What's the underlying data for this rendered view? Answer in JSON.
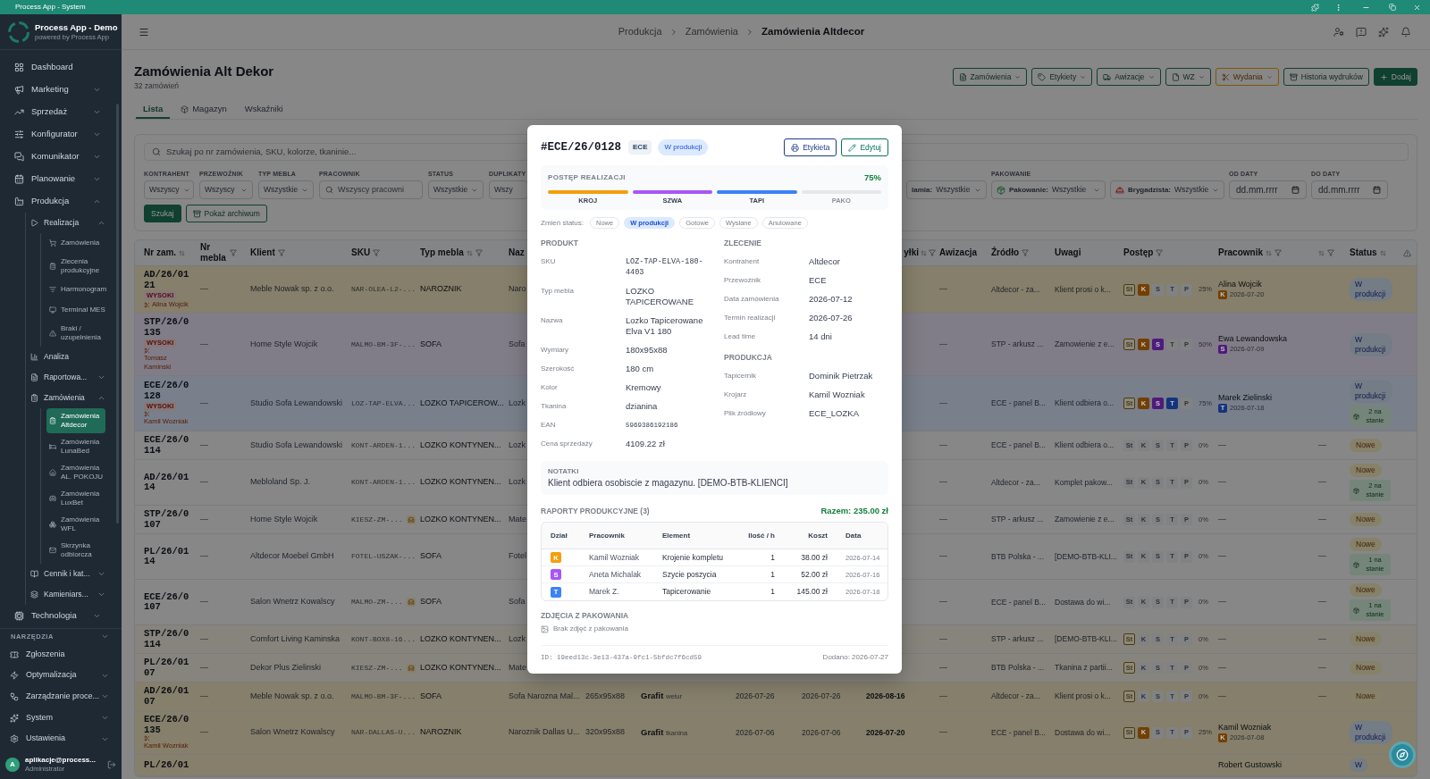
{
  "window": {
    "title": "Process App - System"
  },
  "sidebar": {
    "app_name": "Process App - Demo",
    "app_tagline": "powered by Process App",
    "items": [
      {
        "label": "Dashboard",
        "selected": false
      },
      {
        "label": "Marketing",
        "selected": false,
        "expanded": false
      },
      {
        "label": "Sprzedaż",
        "selected": false,
        "expanded": false
      },
      {
        "label": "Konfigurator",
        "selected": false,
        "expanded": false
      },
      {
        "label": "Komunikator",
        "selected": false,
        "expanded": false
      },
      {
        "label": "Planowanie",
        "selected": false,
        "expanded": false
      },
      {
        "label": "Produkcja",
        "selected": false,
        "expanded": true,
        "children": [
          {
            "label": "Realizacja",
            "selected": false,
            "expanded": true,
            "children": [
              {
                "label": "Zamówienia",
                "selected": false
              },
              {
                "label": "Zlecenia produkcyjne",
                "selected": false
              },
              {
                "label": "Harmonogram",
                "selected": false
              },
              {
                "label": "Terminal MES",
                "selected": false
              },
              {
                "label": "Braki / uzupełnienia",
                "selected": false
              }
            ]
          },
          {
            "label": "Analiza",
            "selected": false
          },
          {
            "label": "Raportowa...",
            "selected": false,
            "expanded": false
          },
          {
            "label": "Zamówienia",
            "selected": false,
            "expanded": true,
            "children": [
              {
                "label": "Zamówienia Altdecor",
                "selected": true
              },
              {
                "label": "Zamówienia LunaBed",
                "selected": false
              },
              {
                "label": "Zamówienia AL. POKOJU",
                "selected": false
              },
              {
                "label": "Zamówienia LuxBet",
                "selected": false
              },
              {
                "label": "Zamówienia WFL",
                "selected": false
              },
              {
                "label": "Skrzynka odbiorcza",
                "selected": false
              }
            ]
          },
          {
            "label": "Cennik i kat...",
            "selected": false,
            "expanded": false
          },
          {
            "label": "Kamieniars...",
            "selected": false,
            "expanded": false
          }
        ]
      },
      {
        "label": "Technologia",
        "selected": false,
        "expanded": false
      }
    ],
    "tools": {
      "title": "NARZĘDZIA",
      "expanded": true,
      "items": [
        {
          "label": "Zgłoszenia",
          "selected": false
        },
        {
          "label": "Optymalizacja",
          "selected": false,
          "expanded": false
        },
        {
          "label": "Zarządzanie proce...",
          "selected": false,
          "expanded": false
        },
        {
          "label": "System",
          "selected": false,
          "expanded": false
        },
        {
          "label": "Ustawienia",
          "selected": false,
          "expanded": false
        }
      ]
    },
    "user": {
      "initial": "A",
      "name": "aplikacje@process...",
      "role": "Administrator"
    }
  },
  "header": {
    "breadcrumbs": [
      {
        "label": "Produkcja",
        "current": false
      },
      {
        "label": "Zamówienia",
        "current": false
      },
      {
        "label": "Zamówienia Altdecor",
        "current": true
      }
    ]
  },
  "page": {
    "title": "Zamówienia Alt Dekor",
    "subtitle": "32 zamówień",
    "actions": [
      {
        "label": "Zamówienia",
        "kind": "outline",
        "dropdown": true
      },
      {
        "label": "Etykiety",
        "kind": "outline",
        "dropdown": true
      },
      {
        "label": "Awizacje",
        "kind": "outline",
        "dropdown": true
      },
      {
        "label": "WZ",
        "kind": "outline",
        "dropdown": true
      },
      {
        "label": "Wydania",
        "kind": "warning",
        "dropdown": true
      },
      {
        "label": "Historia wydruków",
        "kind": "outline",
        "dropdown": false
      },
      {
        "label": "Dodaj",
        "kind": "primary",
        "dropdown": false
      }
    ],
    "tabs": [
      {
        "label": "Lista",
        "selected": true
      },
      {
        "label": "Magazyn",
        "selected": false
      },
      {
        "label": "Wskaźniki",
        "selected": false
      }
    ]
  },
  "filters": {
    "search": {
      "placeholder": "Szukaj po nr zamówienia, SKU, kolorze, tkaninie..."
    },
    "fields": [
      {
        "label": "KONTRAHENT",
        "kind": "select",
        "value": "Wszyscy",
        "dropdown": true
      },
      {
        "label": "PRZEWOŹNIK",
        "kind": "select",
        "value": "Wszyscy",
        "dropdown": true
      },
      {
        "label": "TYP MEBLA",
        "kind": "select",
        "value": "Wszystkie",
        "dropdown": true
      },
      {
        "label": "PRACOWNIK",
        "kind": "search",
        "placeholder": "Wszyscy pracowni"
      },
      {
        "label": "STATUS",
        "kind": "select",
        "value": "Wszystkie",
        "dropdown": true
      },
      {
        "label": "DUPLIKATY",
        "kind": "select",
        "value": "Wszy"
      }
    ],
    "more_fields": [
      {
        "kind": "select",
        "prefix": "lamia:",
        "value": "Wszystkie",
        "dropdown": true
      },
      {
        "label": "PAKOWANIE",
        "kind": "select",
        "prefix": "Pakowanie:",
        "value": "Wszystkie",
        "dropdown": true
      },
      {
        "kind": "select",
        "prefix": "Brygadzista:",
        "value": "Wszystkie",
        "dropdown": true
      },
      {
        "label": "OD DATY",
        "kind": "date",
        "placeholder": "dd.mm.rrrr"
      },
      {
        "label": "DO DATY",
        "kind": "date",
        "placeholder": "dd.mm.rrrr"
      }
    ],
    "buttons": [
      {
        "label": "Szukaj",
        "kind": "primary"
      },
      {
        "label": "Pokaż archiwum",
        "kind": "outline"
      }
    ]
  },
  "table": {
    "columns": [
      {
        "label": "Nr zam.",
        "sort": true,
        "filter": false
      },
      {
        "label": "Nr mebla",
        "sort": false,
        "filter": true
      },
      {
        "label": "Klient",
        "sort": false,
        "filter": true
      },
      {
        "label": "SKU",
        "sort": false,
        "filter": true
      },
      {
        "label": "Typ mebla",
        "sort": true,
        "filter": true
      },
      {
        "label": "Naz",
        "sort": false,
        "filter": false
      },
      {
        "label": "yłki",
        "sort": true,
        "filter": true
      },
      {
        "label": "Awizacja",
        "sort": false,
        "filter": false
      },
      {
        "label": "Źródło",
        "sort": false,
        "filter": true
      },
      {
        "label": "Uwagi",
        "sort": false,
        "filter": false
      },
      {
        "label": "Postęp",
        "sort": false,
        "filter": true
      },
      {
        "label": "Pracownik",
        "sort": true,
        "filter": true
      },
      {
        "sort": true,
        "filter": true
      },
      {
        "label": "Status",
        "sort": true,
        "filter": false
      },
      {
        "kind": "warning"
      }
    ],
    "rows": [
      {
        "color": "#857f6b",
        "order_no": "AD/26/0121",
        "priority": "WYSOKI",
        "cutter": "Alina Wojcik",
        "furniture_no": "—",
        "client": "Meble Nowak sp. z o.o.",
        "sku": "NAR-OLEA-L2-...",
        "type": "NAROZNIK",
        "column_6": "Naro",
        "advice": "—",
        "source": "Altdecor - za...",
        "notes": "Klient prosi o k...",
        "steps": [
          {
            "label": "St",
            "done": false,
            "active": true,
            "color": "#4d3a08"
          },
          {
            "label": "K",
            "done": true,
            "color": "#733f03"
          },
          {
            "label": "S",
            "done": false,
            "active": false
          },
          {
            "label": "T",
            "done": false,
            "active": false
          },
          {
            "label": "P",
            "done": false,
            "active": false
          }
        ],
        "progress": "25%",
        "worker": {
          "kind": "assigned",
          "name": "Alina Wojcik",
          "step": "K",
          "color": "#733f03",
          "date": "2026-07-20"
        },
        "status": {
          "label": "W produkcji",
          "kind": "in_production"
        }
      },
      {
        "color": "#817d88",
        "order_no": "STP/26/0135",
        "priority": "WYSOKI",
        "cutter": "Tomasz Kaminski",
        "furniture_no": "—",
        "client": "Home Style Wojcik",
        "sku": "MALMO-BM-3F-...",
        "type": "SOFA",
        "column_6": "Sofa",
        "advice": "—",
        "source": "STP - arkusz ...",
        "notes": "Zamowienie z e...",
        "steps": [
          {
            "label": "St",
            "done": false,
            "active": true,
            "color": "#4d3a08"
          },
          {
            "label": "K",
            "done": true,
            "color": "#733f03"
          },
          {
            "label": "S",
            "done": true,
            "color": "#4e1b7c"
          },
          {
            "label": "T",
            "done": false,
            "active": false
          },
          {
            "label": "P",
            "done": false,
            "active": false
          }
        ],
        "progress": "50%",
        "worker": {
          "kind": "assigned",
          "name": "Ewa Lewandowska",
          "step": "S",
          "color": "#4e1b7c",
          "date": "2026-07-09"
        },
        "status": {
          "label": "W produkcji",
          "kind": "in_production"
        }
      },
      {
        "color": "#79808b",
        "order_no": "ECE/26/0128",
        "priority": "WYSOKI",
        "cutter": "Kamil Wozniak",
        "furniture_no": "—",
        "client": "Studio Sofa Lewandowski",
        "sku": "LOZ-TAP-ELVA...",
        "type": "LOZKO TAPICEROW...",
        "column_6": "Lozk",
        "advice": "—",
        "source": "ECE - panel B...",
        "notes": "Klient odbiera o...",
        "steps": [
          {
            "label": "St",
            "done": false,
            "active": true,
            "color": "#4d3a08"
          },
          {
            "label": "K",
            "done": true,
            "color": "#733f03"
          },
          {
            "label": "S",
            "done": true,
            "color": "#4e1b7c"
          },
          {
            "label": "T",
            "done": true,
            "color": "#14347d"
          },
          {
            "label": "P",
            "done": false,
            "active": false
          }
        ],
        "progress": "75%",
        "worker": {
          "kind": "assigned",
          "name": "Marek Zielinski",
          "step": "T",
          "color": "#14347d",
          "date": "2026-07-18"
        },
        "status": {
          "label": "W produkcji",
          "kind": "in_production"
        },
        "stock": "2 na stanie"
      },
      {
        "color": "#878787",
        "order_no": "ECE/26/0114",
        "furniture_no": "—",
        "client": "Studio Sofa Lewandowski",
        "sku": "KONT-ARDEN-1...",
        "type": "LOZKO KONTYNEN...",
        "column_6": "Lozk",
        "advice": "—",
        "source": "ECE - panel B...",
        "notes": "Klient odbiera o...",
        "steps": [
          {
            "label": "St",
            "done": false,
            "active": false
          },
          {
            "label": "K",
            "done": false,
            "active": false
          },
          {
            "label": "S",
            "done": false,
            "active": false
          },
          {
            "label": "T",
            "done": false,
            "active": false
          },
          {
            "label": "P",
            "done": false,
            "active": false
          }
        ],
        "progress": "0%",
        "worker": {
          "kind": "none",
          "name": "—"
        },
        "column_17": "—",
        "status": {
          "label": "Nowe",
          "kind": "new"
        }
      },
      {
        "color": "#878787",
        "order_no": "AD/26/0114",
        "furniture_no": "—",
        "client": "Mebloland Sp. J.",
        "sku": "KONT-ARDEN-1...",
        "type": "LOZKO KONTYNEN...",
        "column_6": "Lozk",
        "advice": "—",
        "source": "Altdecor - za...",
        "notes": "Komplet pakow...",
        "steps": [
          {
            "label": "St",
            "done": false,
            "active": false
          },
          {
            "label": "K",
            "done": false,
            "active": false
          },
          {
            "label": "S",
            "done": false,
            "active": false
          },
          {
            "label": "T",
            "done": false,
            "active": false
          },
          {
            "label": "P",
            "done": false,
            "active": false
          }
        ],
        "progress": "0%",
        "worker": {
          "kind": "none",
          "name": "—"
        },
        "column_17": "—",
        "status": {
          "label": "Nowe",
          "kind": "new"
        },
        "stock": "2 na stanie"
      },
      {
        "color": "#878787",
        "order_no": "STP/26/0107",
        "furniture_no": "—",
        "client": "Home Style Wojcik",
        "sku": "KIESZ-ZM-...",
        "furniture_badge": true,
        "type": "LOZKO KONTYNEN...",
        "column_6": "Mate",
        "advice": "—",
        "source": "STP - arkusz ...",
        "notes": "Zamowienie z e...",
        "steps": [
          {
            "label": "St",
            "done": false,
            "active": false
          },
          {
            "label": "K",
            "done": false,
            "active": false
          },
          {
            "label": "S",
            "done": false,
            "active": false
          },
          {
            "label": "T",
            "done": false,
            "active": false
          },
          {
            "label": "P",
            "done": false,
            "active": false
          }
        ],
        "progress": "0%",
        "worker": {
          "kind": "none",
          "name": "—"
        },
        "column_17": "—",
        "status": {
          "label": "Nowe",
          "kind": "new"
        }
      },
      {
        "color": "#878787",
        "order_no": "PL/26/0114",
        "furniture_no": "—",
        "client": "Altdecor Moebel GmbH",
        "sku": "FOTEL-USZAK-...",
        "type": "SOFA",
        "column_6": "Fotel",
        "advice": "—",
        "source": "BTB Polska - ...",
        "notes": "[DEMO-BTB-KLI...",
        "steps": [
          {
            "label": "St",
            "done": false,
            "active": false
          },
          {
            "label": "K",
            "done": false,
            "active": false
          },
          {
            "label": "S",
            "done": false,
            "active": false
          },
          {
            "label": "T",
            "done": false,
            "active": false
          },
          {
            "label": "P",
            "done": false,
            "active": false
          }
        ],
        "progress": "0%",
        "worker": {
          "kind": "none",
          "name": "—"
        },
        "column_17": "—",
        "status": {
          "label": "Nowe",
          "kind": "new"
        },
        "stock": "1 na stanie"
      },
      {
        "color": "#878787",
        "order_no": "ECE/26/0107",
        "furniture_no": "—",
        "client": "Salon Wnetrz Kowalscy",
        "sku": "MALMO-ZM-...",
        "furniture_badge": true,
        "type": "SOFA",
        "column_6": "Sofa",
        "advice": "—",
        "source": "ECE - panel B...",
        "notes": "Dostawa do wi...",
        "steps": [
          {
            "label": "St",
            "done": false,
            "active": false
          },
          {
            "label": "K",
            "done": false,
            "active": false
          },
          {
            "label": "S",
            "done": false,
            "active": false
          },
          {
            "label": "T",
            "done": false,
            "active": false
          },
          {
            "label": "P",
            "done": false,
            "active": false
          }
        ],
        "progress": "0%",
        "worker": {
          "kind": "none",
          "name": "—"
        },
        "column_17": "—",
        "status": {
          "label": "Nowe",
          "kind": "new"
        },
        "stock": "1 na stanie"
      },
      {
        "color": "#86847c",
        "order_no": "STP/26/0114",
        "furniture_no": "—",
        "client": "Comfort Living Kaminska",
        "sku": "KONT-BOX8-16...",
        "type": "LOZKO KONTYNEN...",
        "column_6": "Lozk",
        "advice": "—",
        "source": "STP - arkusz ...",
        "notes": "[DEMO-BTB-KLI...",
        "steps": [
          {
            "label": "St",
            "done": false,
            "active": true,
            "color": "#4d3a08"
          },
          {
            "label": "K",
            "done": false,
            "active": false
          },
          {
            "label": "S",
            "done": false,
            "active": false
          },
          {
            "label": "T",
            "done": false,
            "active": false
          },
          {
            "label": "P",
            "done": false,
            "active": false
          }
        ],
        "progress": "0%",
        "worker": {
          "kind": "none",
          "name": "—"
        },
        "column_17": "—",
        "status": {
          "label": "Nowe",
          "kind": "new"
        }
      },
      {
        "color": "#86847c",
        "order_no": "PL/26/0107",
        "furniture_no": "—",
        "client": "Dekor Plus Zielinski",
        "sku": "KIESZ-ZM-...",
        "furniture_badge": true,
        "type": "LOZKO KONTYNEN...",
        "column_6": "Mate",
        "advice": "—",
        "source": "BTB Polska - ...",
        "notes": "Tkanina z partii...",
        "steps": [
          {
            "label": "St",
            "done": false,
            "active": true,
            "color": "#4d3a08"
          },
          {
            "label": "K",
            "done": false,
            "active": false
          },
          {
            "label": "S",
            "done": false,
            "active": false
          },
          {
            "label": "T",
            "done": false,
            "active": false
          },
          {
            "label": "P",
            "done": false,
            "active": false
          }
        ],
        "progress": "0%",
        "worker": {
          "kind": "none",
          "name": "—"
        },
        "column_17": "—",
        "status": {
          "label": "Nowe",
          "kind": "new"
        }
      },
      {
        "color": "#857f6b",
        "order_no": "AD/26/0107",
        "furniture_no": "—",
        "client": "Meble Nowak sp. z o.o.",
        "sku": "MALMO-BM-3F-...",
        "type": "SOFA",
        "column_6": "Sofa Narozna Mal...",
        "column_7": "265x95x88",
        "column_8": {
          "value": "Grafit",
          "note": "welur"
        },
        "column_9": "2026-07-26",
        "column_10": "2026-07-26",
        "column_11": "2026-08-16",
        "advice": "—",
        "source": "Altdecor - za...",
        "notes": "Klient prosi o k...",
        "steps": [
          {
            "label": "St",
            "done": false,
            "active": true,
            "color": "#4d3a08"
          },
          {
            "label": "K",
            "done": false,
            "active": false
          },
          {
            "label": "S",
            "done": false,
            "active": false
          },
          {
            "label": "T",
            "done": false,
            "active": false
          },
          {
            "label": "P",
            "done": false,
            "active": false
          }
        ],
        "progress": "0%",
        "worker": {
          "kind": "none",
          "name": "—"
        },
        "column_17": "—",
        "status": {
          "label": "Nowe",
          "kind": "new"
        }
      },
      {
        "color": "#857f6b",
        "order_no": "ECE/26/0135",
        "cutter": "Kamil Wozniak",
        "furniture_no": "—",
        "client": "Salon Wnetrz Kowalscy",
        "sku": "NAR-DALLAS-U...",
        "type": "NAROZNIK",
        "column_6": "Naroznik Dallas U...",
        "column_7": "320x95x88",
        "column_8": {
          "value": "Grafit",
          "note": "tkanina"
        },
        "column_9": "2026-07-06",
        "column_10": "2026-07-06",
        "column_11": "2026-07-20",
        "advice": "—",
        "source": "ECE - panel B...",
        "notes": "Dostawa do wi...",
        "steps": [
          {
            "label": "St",
            "done": false,
            "active": true,
            "color": "#4d3a08"
          },
          {
            "label": "K",
            "done": true,
            "color": "#733f03"
          },
          {
            "label": "S",
            "done": false,
            "active": false
          },
          {
            "label": "T",
            "done": false,
            "active": false
          },
          {
            "label": "P",
            "done": false,
            "active": false
          }
        ],
        "progress": "25%",
        "worker": {
          "kind": "assigned",
          "name": "Kamil Wozniak",
          "step": "K",
          "color": "#733f03",
          "date": "2026-07-08"
        },
        "status": {
          "label": "W produkcji",
          "kind": "in_production"
        }
      },
      {
        "color": "#857f6b",
        "order_no": "PL/26/01",
        "worker": {
          "kind": "assigned",
          "name": "Robert Gustowski"
        },
        "status": {
          "label": "W",
          "kind": "in_production"
        }
      }
    ]
  },
  "order_modal": {
    "number": "#ECE/26/0128",
    "carrier_badge": "ECE",
    "status_badge": "W produkcji",
    "buttons": [
      {
        "label": "Etykieta",
        "kind": "print"
      },
      {
        "label": "Edytuj",
        "kind": "edit"
      }
    ],
    "progress": {
      "title": "POSTĘP REALIZACJI",
      "percent": "75%",
      "stages": [
        {
          "label": "KROJ",
          "done": true,
          "color": "#f59e0b"
        },
        {
          "label": "SZWA",
          "done": true,
          "color": "#a855f7"
        },
        {
          "label": "TAPI",
          "done": true,
          "color": "#3b82f6"
        },
        {
          "label": "PAKO",
          "done": false
        }
      ]
    },
    "status_switch": {
      "label": "Zmień status:",
      "options": [
        {
          "label": "Nowe",
          "selected": false
        },
        {
          "label": "W produkcji",
          "selected": true
        },
        {
          "label": "Gotowe",
          "selected": false
        },
        {
          "label": "Wysłane",
          "selected": false
        },
        {
          "label": "Anulowane",
          "selected": false
        }
      ]
    },
    "product": {
      "title": "PRODUKT",
      "fields": [
        {
          "label": "SKU",
          "value": "LOZ-TAP-ELVA-180-4403",
          "kind": "mono"
        },
        {
          "label": "Typ mebla",
          "value": "LOZKO TAPICEROWANE",
          "kind": "text"
        },
        {
          "label": "Nazwa",
          "value": "Lozko Tapicerowane Elva V1 180",
          "kind": "text"
        },
        {
          "label": "Wymiary",
          "value": "180x95x88",
          "kind": "text"
        },
        {
          "label": "Szerokość",
          "value": "180 cm",
          "kind": "text"
        },
        {
          "label": "Kolor",
          "value": "Kremowy",
          "kind": "text"
        },
        {
          "label": "Tkanina",
          "value": "dzianina",
          "kind": "text"
        },
        {
          "label": "EAN",
          "value": "5969386192186",
          "kind": "mono"
        },
        {
          "label": "Cena sprzedaży",
          "value": "4109.22 zł",
          "kind": "text"
        }
      ]
    },
    "order": {
      "title": "ZLECENIE",
      "fields": [
        {
          "label": "Kontrahent",
          "value": "Altdecor",
          "kind": "text"
        },
        {
          "label": "Przewoźnik",
          "value": "ECE",
          "kind": "text"
        },
        {
          "label": "Data zamówienia",
          "value": "2026-07-12",
          "kind": "text"
        },
        {
          "label": "Termin realizacji",
          "value": "2026-07-26",
          "kind": "text"
        },
        {
          "label": "Lead time",
          "value": "14 dni",
          "kind": "text"
        }
      ]
    },
    "production": {
      "title": "PRODUKCJA",
      "fields": [
        {
          "label": "Tapicernik",
          "value": "Dominik Pietrzak",
          "kind": "text"
        },
        {
          "label": "Krojarz",
          "value": "Kamil Wozniak",
          "kind": "text"
        },
        {
          "label": "Plik źródłowy",
          "value": "ECE_LOZKA",
          "kind": "text"
        }
      ]
    },
    "notes": {
      "title": "NOTATKI",
      "text": "Klient odbiera osobiscie z magazynu. [DEMO-BTB-KLIENCI]"
    },
    "reports": {
      "title": "RAPORTY PRODUKCYJNE (3)",
      "total": "Razem: 235.00 zł",
      "columns": [
        "Dział",
        "Pracownik",
        "Element",
        "Ilość / h",
        "Koszt",
        "Data"
      ],
      "rows": [
        {
          "dept": "K",
          "color": "#f59e0b",
          "worker": "Kamil Wozniak",
          "element": "Krojenie kompletu",
          "qty": "1",
          "cost": "38.00 zł",
          "date": "2026-07-14"
        },
        {
          "dept": "S",
          "color": "#a855f7",
          "worker": "Aneta Michalak",
          "element": "Szycie poszycia",
          "qty": "1",
          "cost": "52.00 zł",
          "date": "2026-07-16"
        },
        {
          "dept": "T",
          "color": "#3b82f6",
          "worker": "Marek Z.",
          "element": "Tapicerowanie",
          "qty": "1",
          "cost": "145.00 zł",
          "date": "2026-07-18"
        }
      ]
    },
    "photos": {
      "title": "ZDJĘCIA Z PAKOWANIA",
      "empty": "Brak zdjęć z pakowania"
    },
    "footer": {
      "id": "ID: 19eed13c-3e13-437a-9fc1-5bfdc7f6cd59",
      "added": "Dodano: 2026-07-27"
    }
  }
}
